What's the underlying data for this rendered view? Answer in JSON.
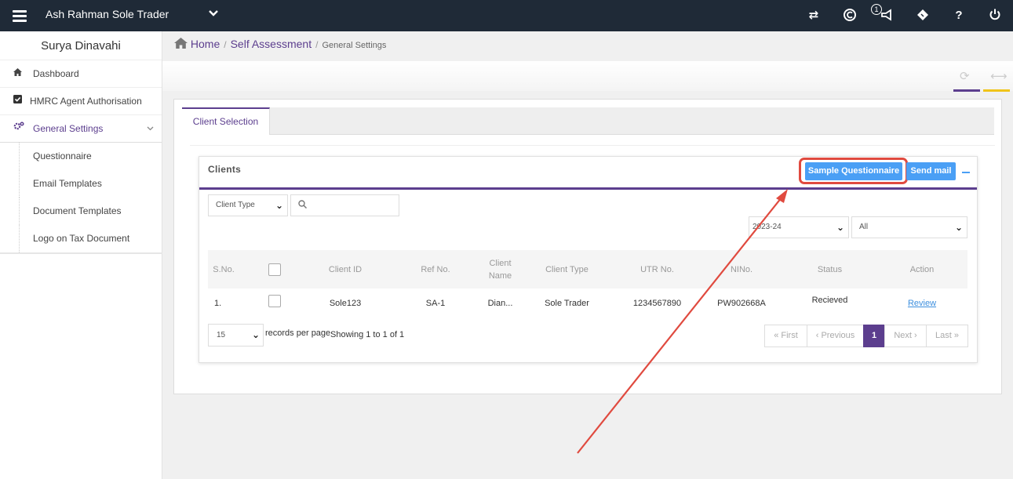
{
  "header": {
    "company": "Ash Rahman Sole Trader",
    "notification_count": "1",
    "icons": [
      "menu-icon",
      "chevron-down-icon",
      "transfer-icon",
      "currency-icon",
      "megaphone-icon",
      "tag-icon",
      "help-icon",
      "power-icon"
    ],
    "help_label": "?"
  },
  "sidebar": {
    "user_name": "Surya Dinavahi",
    "items": [
      {
        "label": "Dashboard",
        "icon": "home-icon"
      },
      {
        "label": "HMRC Agent Authorisation",
        "icon": "checkbox-icon"
      },
      {
        "label": "General Settings",
        "icon": "gears-icon",
        "active": true
      }
    ],
    "sub_items": [
      {
        "label": "Questionnaire"
      },
      {
        "label": "Email Templates"
      },
      {
        "label": "Document Templates"
      },
      {
        "label": "Logo on Tax Document"
      }
    ]
  },
  "breadcrumb": {
    "home": "Home",
    "parent": "Self Assessment",
    "current": "General Settings"
  },
  "tabs": [
    {
      "label": "Client Selection",
      "active": true
    }
  ],
  "clients": {
    "title": "Clients",
    "sample_button": "Sample Questionnaire",
    "send_button": "Send mail",
    "client_type_filter": "Client Type",
    "search_placeholder": "",
    "year_filter": "2023-24",
    "status_filter": "All",
    "columns": [
      "S.No.",
      "",
      "Client ID",
      "Ref No.",
      "Client Name",
      "Client Type",
      "UTR No.",
      "NINo.",
      "Status",
      "Action"
    ],
    "rows": [
      {
        "sno": "1.",
        "client_id": "Sole123",
        "ref": "SA-1",
        "name": "Dian...",
        "type": "Sole Trader",
        "utr": "1234567890",
        "nino": "PW902668A",
        "status": "Recieved",
        "action": "Review"
      }
    ],
    "page_size": "15",
    "records_label": "records per page",
    "showing": "Showing 1 to 1 of 1",
    "pagination": {
      "first": "« First",
      "previous": "‹ Previous",
      "current": "1",
      "next": "Next ›",
      "last": "Last »"
    }
  },
  "colors": {
    "topbar": "#1f2a37",
    "accent": "#5c3e8e",
    "button": "#4a9ff5",
    "highlight": "#e04a3f"
  }
}
